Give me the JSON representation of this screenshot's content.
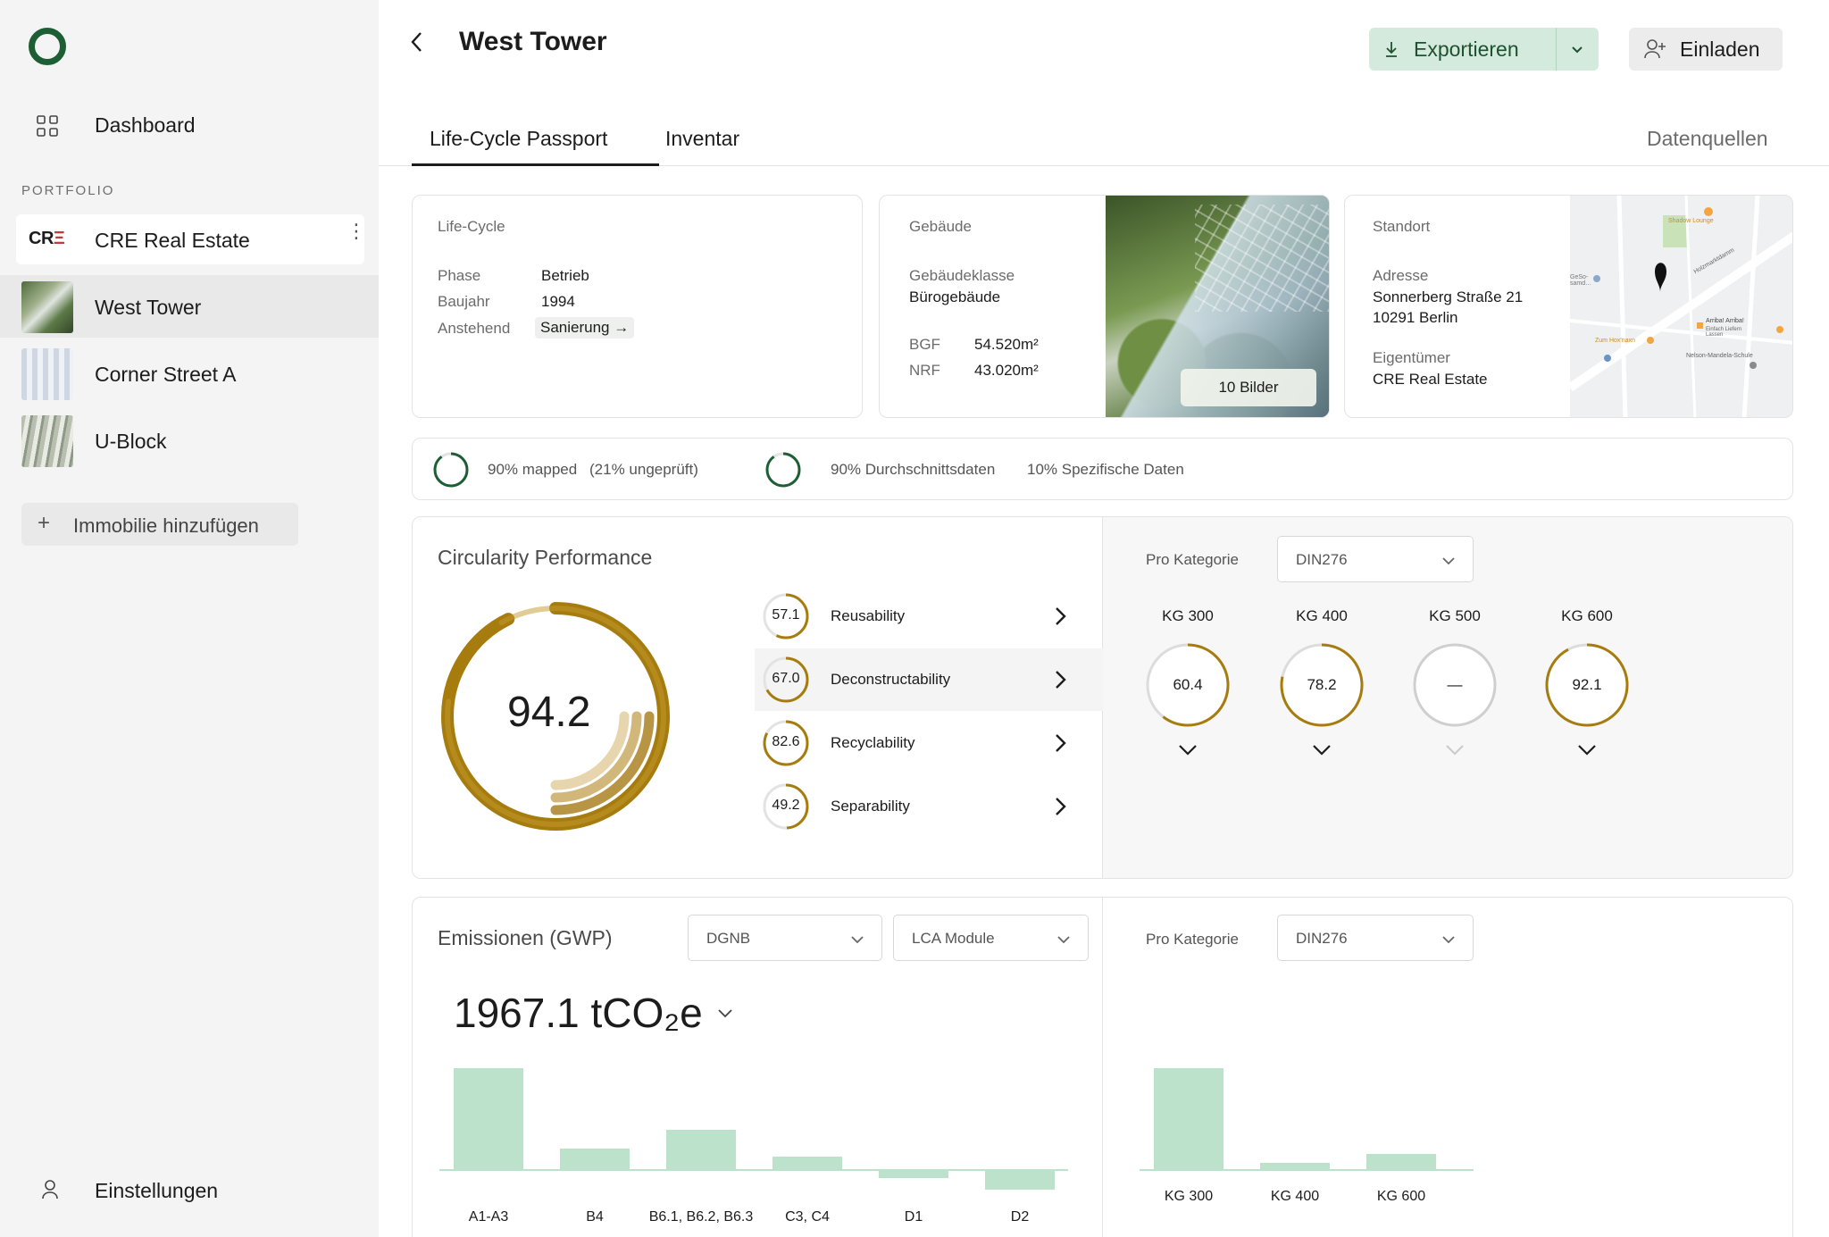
{
  "sidebar": {
    "dashboard_label": "Dashboard",
    "portfolio_heading": "PORTFOLIO",
    "portfolio": {
      "logo_prefix": "CR",
      "logo_suffix": "Ξ",
      "name": "CRE Real Estate",
      "menu": "⋮"
    },
    "buildings": [
      {
        "name": "West Tower"
      },
      {
        "name": "Corner Street A"
      },
      {
        "name": "U-Block"
      }
    ],
    "add_plus": "+",
    "add_label": "Immobilie hinzufügen",
    "settings_label": "Einstellungen"
  },
  "header": {
    "title": "West Tower",
    "export_label": "Exportieren",
    "invite_label": "Einladen"
  },
  "tabs": {
    "passport": "Life-Cycle Passport",
    "inventory": "Inventar",
    "sources": "Datenquellen"
  },
  "lifecycle": {
    "title": "Life-Cycle",
    "phase_label": "Phase",
    "phase": "Betrieb",
    "year_label": "Baujahr",
    "year": "1994",
    "pending_label": "Anstehend",
    "pending": "Sanierung →"
  },
  "building": {
    "title": "Gebäude",
    "class_label": "Gebäudeklasse",
    "class": "Bürogebäude",
    "bgf_label": "BGF",
    "bgf": "54.520m²",
    "nrf_label": "NRF",
    "nrf": "43.020m²",
    "images_button": "10 Bilder"
  },
  "location": {
    "title": "Standort",
    "address_label": "Adresse",
    "address_line1": "Sonnerberg Straße 21",
    "address_line2": "10291 Berlin",
    "owner_label": "Eigentümer",
    "owner": "CRE Real Estate",
    "map_labels": {
      "shadow_lounge": "Shadow Lounge",
      "gesobau": "GeSo-\nsamd…",
      "zum_hoxhaxn": "Zum Hox'naxn",
      "arriba": "Arriba! Arriba!",
      "arriba_sub": "Einfach Liefern Lassen",
      "nelson": "Nelson-Mandela-Schule",
      "holzmarkt": "Holzmarktdamm"
    }
  },
  "mapping": {
    "mapped": "90% mapped",
    "unchecked": "(21% ungeprüft)",
    "avg_data": "90% Durchschnittsdaten",
    "specific": "10% Spezifische Daten"
  },
  "circularity": {
    "title": "Circularity Performance",
    "score": "94.2",
    "metrics": [
      {
        "value": "57.1",
        "name": "Reusability"
      },
      {
        "value": "67.0",
        "name": "Deconstructability"
      },
      {
        "value": "82.6",
        "name": "Recyclability"
      },
      {
        "value": "49.2",
        "name": "Separability"
      }
    ],
    "per_category_label": "Pro Kategorie",
    "category_dropdown": "DIN276",
    "categories": [
      {
        "name": "KG 300",
        "value": "60.4"
      },
      {
        "name": "KG 400",
        "value": "78.2"
      },
      {
        "name": "KG 500",
        "value": "—"
      },
      {
        "name": "KG 600",
        "value": "92.1"
      }
    ]
  },
  "emissions": {
    "title": "Emissionen (GWP)",
    "dropdown_standard": "DGNB",
    "dropdown_module": "LCA Module",
    "total": "1967.1 tCO₂e",
    "per_category_label": "Pro Kategorie",
    "category_dropdown": "DIN276"
  },
  "chart_data": [
    {
      "type": "bar",
      "categories": [
        "A1-A3",
        "B4",
        "B6.1, B6.2, B6.3",
        "C3, C4",
        "D1",
        "D2"
      ],
      "values": [
        100,
        20,
        39,
        12,
        -7,
        -19
      ],
      "ylim": [
        -25,
        110
      ]
    },
    {
      "type": "bar",
      "categories": [
        "KG 300",
        "KG 400",
        "KG 600"
      ],
      "values": [
        100,
        6,
        15
      ],
      "ylim": [
        0,
        110
      ]
    }
  ],
  "colors": {
    "brand_green": "#1d5e34",
    "gold": "#a97f0b",
    "bar_green": "#bde2cb",
    "export_bg": "#d4eadc"
  }
}
